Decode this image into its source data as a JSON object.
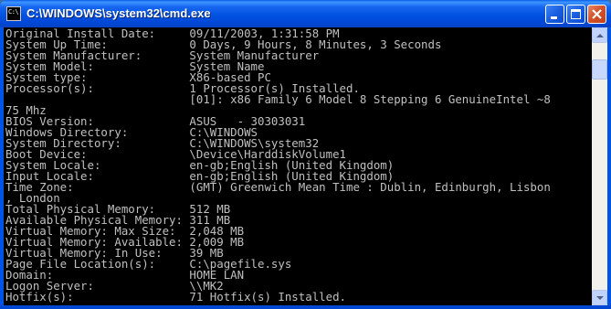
{
  "window": {
    "title": "C:\\WINDOWS\\system32\\cmd.exe",
    "icon_text": "C:\\"
  },
  "console": {
    "lines": [
      "Original Install Date:     09/11/2003, 1:31:58 PM",
      "System Up Time:            0 Days, 9 Hours, 8 Minutes, 3 Seconds",
      "System Manufacturer:       System Manufacturer",
      "System Model:              System Name",
      "System type:               X86-based PC",
      "Processor(s):              1 Processor(s) Installed.",
      "                           [01]: x86 Family 6 Model 8 Stepping 6 GenuineIntel ~8",
      "75 Mhz",
      "BIOS Version:              ASUS   - 30303031",
      "Windows Directory:         C:\\WINDOWS",
      "System Directory:          C:\\WINDOWS\\system32",
      "Boot Device:               \\Device\\HarddiskVolume1",
      "System Locale:             en-gb;English (United Kingdom)",
      "Input Locale:              en-gb;English (United Kingdom)",
      "Time Zone:                 (GMT) Greenwich Mean Time : Dublin, Edinburgh, Lisbon",
      ", London",
      "Total Physical Memory:     512 MB",
      "Available Physical Memory: 311 MB",
      "Virtual Memory: Max Size:  2,048 MB",
      "Virtual Memory: Available: 2,009 MB",
      "Virtual Memory: In Use:    39 MB",
      "Page File Location(s):     C:\\pagefile.sys",
      "Domain:                    HOME LAN",
      "Logon Server:              \\\\MK2",
      "Hotfix(s):                 71 Hotfix(s) Installed."
    ]
  },
  "colors": {
    "titlebar": "#0054e3",
    "console_bg": "#000000",
    "console_fg": "#c0c0c0"
  },
  "icons": {
    "minimize": "minimize-icon",
    "maximize": "maximize-icon",
    "close": "close-icon",
    "app": "cmd-icon"
  }
}
